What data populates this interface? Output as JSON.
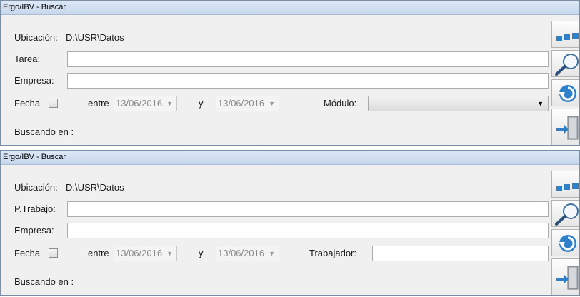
{
  "panels": [
    {
      "title": "Ergo/IBV - Buscar",
      "ubicacion_label": "Ubicación:",
      "ubicacion_value": "D:\\USR\\Datos",
      "field2_label": "Tarea:",
      "field2_value": "",
      "empresa_label": "Empresa:",
      "empresa_value": "",
      "fecha_label": "Fecha",
      "entre_label": "entre",
      "date_from": "13/06/2016",
      "y_label": "y",
      "date_to": "13/06/2016",
      "extra_label": "Módulo:",
      "extra_value": "",
      "buscando_label": "Buscando en :"
    },
    {
      "title": "Ergo/IBV - Buscar",
      "ubicacion_label": "Ubicación:",
      "ubicacion_value": "D:\\USR\\Datos",
      "field2_label": "P.Trabajo:",
      "field2_value": "",
      "empresa_label": "Empresa:",
      "empresa_value": "",
      "fecha_label": "Fecha",
      "entre_label": "entre",
      "date_from": "13/06/2016",
      "y_label": "y",
      "date_to": "13/06/2016",
      "extra_label": "Trabajador:",
      "extra_value": "",
      "buscando_label": "Buscando en :"
    }
  ],
  "side_buttons": [
    "dots-icon",
    "magnifier-icon",
    "refresh-icon",
    "exit-door-icon"
  ],
  "colors": {
    "accent": "#2f7fc9",
    "titlebar": "#c7d7ec",
    "panel_bg": "#f0f0f0"
  }
}
